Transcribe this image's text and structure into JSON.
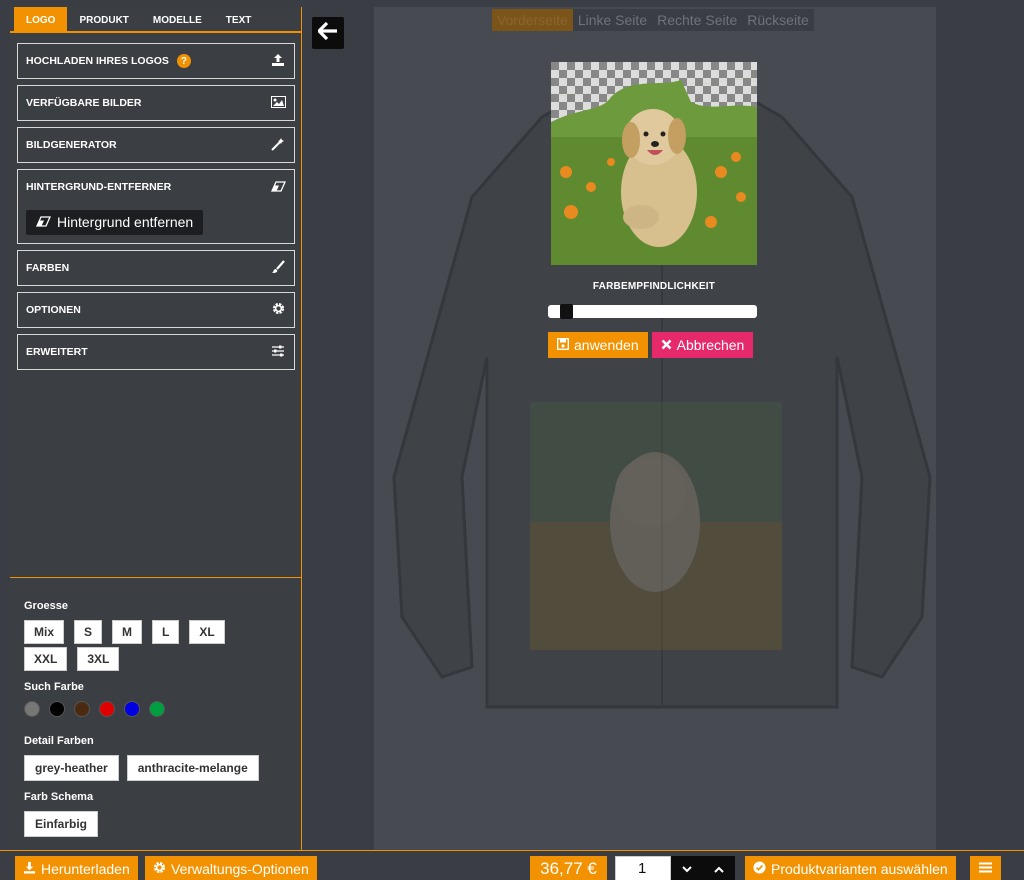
{
  "sidebar": {
    "tabs": [
      {
        "label": "LOGO"
      },
      {
        "label": "PRODUKT"
      },
      {
        "label": "MODELLE"
      },
      {
        "label": "TEXT"
      }
    ],
    "sections": {
      "upload": {
        "label": "HOCHLADEN IHRES LOGOS",
        "help": "?",
        "icon": "upload-icon"
      },
      "images": {
        "label": "VERFÜGBARE BILDER",
        "icon": "image-icon"
      },
      "generator": {
        "label": "BILDGENERATOR",
        "icon": "magic-wand-icon"
      },
      "bg_remover": {
        "label": "HINTERGRUND-ENTFERNER",
        "icon": "eraser-icon",
        "button": "Hintergrund entfernen"
      },
      "colors": {
        "label": "FARBEN",
        "icon": "brush-icon"
      },
      "options": {
        "label": "OPTIONEN",
        "icon": "gear-icon"
      },
      "advanced": {
        "label": "ERWEITERT",
        "icon": "sliders-icon"
      }
    },
    "filters": {
      "size_label": "Groesse",
      "sizes": [
        "Mix",
        "S",
        "M",
        "L",
        "XL",
        "XXL",
        "3XL"
      ],
      "search_color_label": "Such Farbe",
      "swatches": [
        "#777777",
        "#000000",
        "#4a2a10",
        "#e00000",
        "#0000e0",
        "#00a040"
      ],
      "detail_colors_label": "Detail Farben",
      "detail_colors": [
        "grey-heather",
        "anthracite-melange"
      ],
      "scheme_label": "Farb Schema",
      "scheme": "Einfarbig"
    }
  },
  "canvas": {
    "view_tabs": [
      {
        "label": "Vorderseite",
        "active": true
      },
      {
        "label": "Linke Seite"
      },
      {
        "label": "Rechte Seite"
      },
      {
        "label": "Rückseite"
      }
    ],
    "editor": {
      "label": "FARBEMPFINDLICHKEIT",
      "sensitivity": 0.06,
      "apply": "anwenden",
      "cancel": "Abbrechen"
    }
  },
  "bottom": {
    "download": "Herunterladen",
    "admin": "Verwaltungs-Optionen",
    "price": "36,77 €",
    "quantity": "1",
    "variants": "Produktvarianten auswählen"
  },
  "colors": {
    "accent": "#f39200",
    "danger": "#e5296b"
  }
}
